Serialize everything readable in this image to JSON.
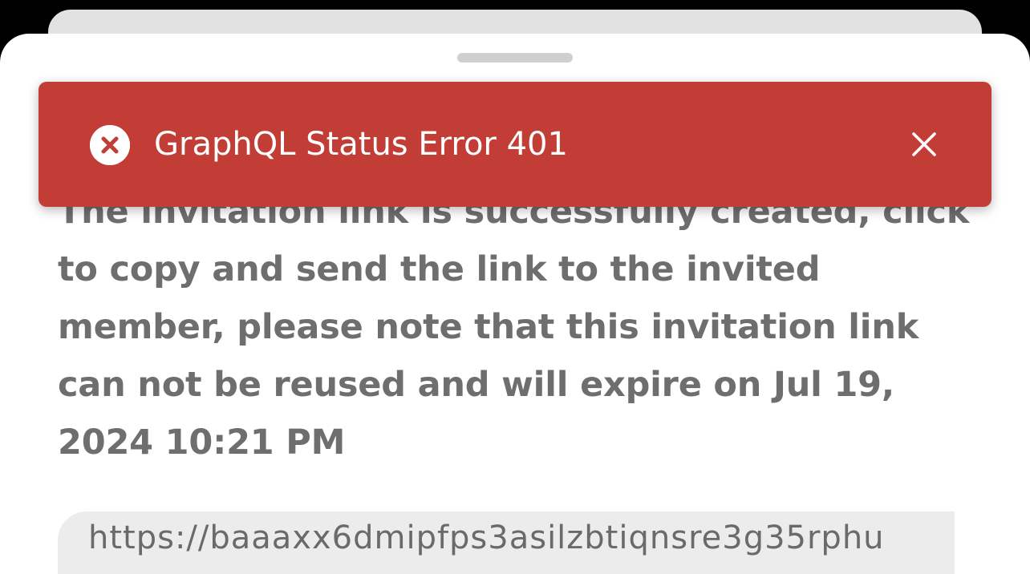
{
  "toast": {
    "title": "GraphQL Status Error 401",
    "icon": "error-circle-x-icon",
    "close_icon": "close-icon",
    "color": "#c13d35"
  },
  "invite": {
    "message": "The invitation link is successfully created, click to copy and send the link to the invited member, please note that this invitation link can not be reused and will expire on Jul 19, 2024 10:21 PM",
    "link": "https://baaaxx6dmipfps3asilzbtiqnsre3g35rphu"
  }
}
